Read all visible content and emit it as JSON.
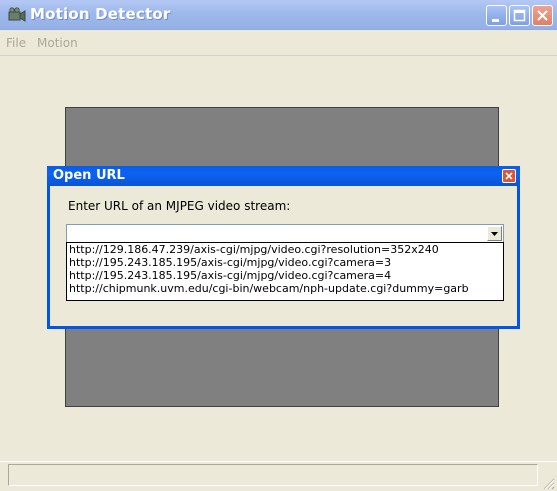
{
  "window": {
    "title": "Motion Detector",
    "icon": "app-icon",
    "controls": [
      "minimize",
      "maximize",
      "close"
    ]
  },
  "menu": {
    "file": "File",
    "motion": "Motion"
  },
  "dialog": {
    "title": "Open URL",
    "prompt": "Enter URL of an MJPEG video stream:",
    "combo_value": "",
    "options": [
      "http://129.186.47.239/axis-cgi/mjpg/video.cgi?resolution=352x240",
      "http://195.243.185.195/axis-cgi/mjpg/video.cgi?camera=3",
      "http://195.243.185.195/axis-cgi/mjpg/video.cgi?camera=4",
      "http://chipmunk.uvm.edu/cgi-bin/webcam/nph-update.cgi?dummy=garb"
    ]
  },
  "colors": {
    "dialog_title_blue": "#0a5ee8",
    "titlebar_inactive": "#9db9eb",
    "video_gray": "#808080"
  }
}
